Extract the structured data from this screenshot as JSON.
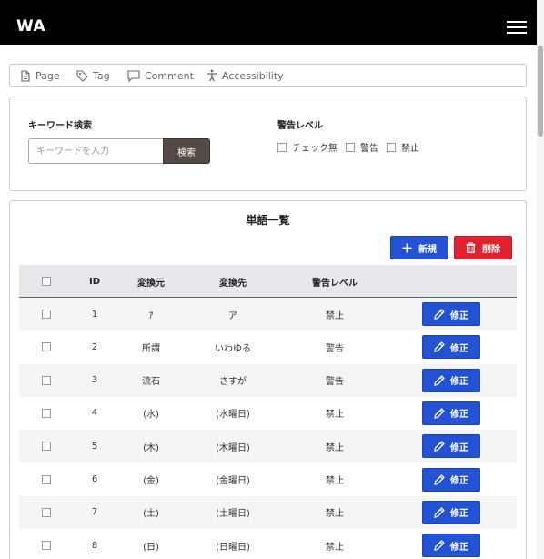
{
  "header": {
    "logo": "WA",
    "menu_icon": "hamburger-icon"
  },
  "tabs": [
    {
      "label": "Page",
      "icon": "page-icon"
    },
    {
      "label": "Tag",
      "icon": "tag-icon"
    },
    {
      "label": "Comment",
      "icon": "comment-icon"
    },
    {
      "label": "Accessibility",
      "icon": "accessibility-icon"
    }
  ],
  "search": {
    "keyword_label": "キーワード検索",
    "placeholder": "キーワードを入力",
    "value": "",
    "button_label": "検索",
    "level_label": "警告レベル",
    "level_options": [
      "チェック無",
      "警告",
      "禁止"
    ]
  },
  "list": {
    "title": "単語一覧",
    "new_button": "新規",
    "delete_button": "削除",
    "columns": {
      "id": "ID",
      "source": "変換元",
      "target": "変換先",
      "level": "警告レベル"
    },
    "edit_label": "修正",
    "rows": [
      {
        "id": "1",
        "source": "ｱ",
        "target": "ア",
        "level": "禁止"
      },
      {
        "id": "2",
        "source": "所謂",
        "target": "いわゆる",
        "level": "警告"
      },
      {
        "id": "3",
        "source": "流石",
        "target": "さすが",
        "level": "警告"
      },
      {
        "id": "4",
        "source": "(水)",
        "target": "(水曜日)",
        "level": "禁止"
      },
      {
        "id": "5",
        "source": "(木)",
        "target": "(木曜日)",
        "level": "禁止"
      },
      {
        "id": "6",
        "source": "(金)",
        "target": "(金曜日)",
        "level": "禁止"
      },
      {
        "id": "7",
        "source": "(土)",
        "target": "(土曜日)",
        "level": "禁止"
      },
      {
        "id": "8",
        "source": "(日)",
        "target": "(日曜日)",
        "level": "禁止"
      }
    ]
  },
  "colors": {
    "primary": "#2353d3",
    "danger": "#e3202e",
    "search_button": "#544a45",
    "header": "#000000"
  }
}
